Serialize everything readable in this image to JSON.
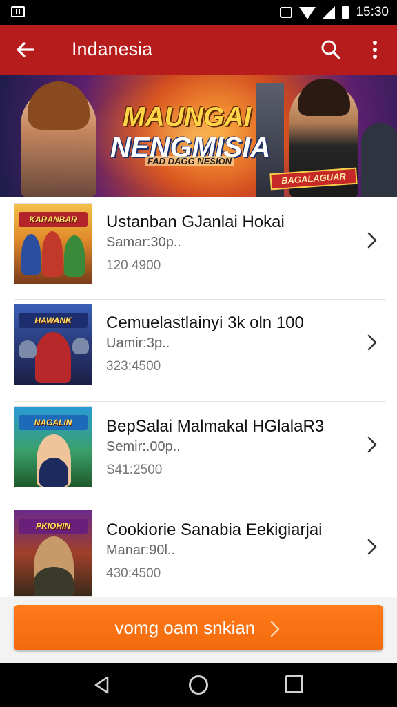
{
  "status_bar": {
    "time": "15:30",
    "icons": [
      "gallery-icon",
      "vibrate-icon",
      "wifi-icon",
      "signal-icon",
      "battery-icon"
    ]
  },
  "app_bar": {
    "title": "Indanesia",
    "back_icon": "arrow-back-icon",
    "search_icon": "search-icon",
    "more_icon": "more-vert-icon"
  },
  "banner": {
    "title_line1": "MAUNGAI",
    "title_line2": "NENGMISIA",
    "subtitle": "FAD DAGG NESION",
    "sign": "BAGALAGUAR"
  },
  "items": [
    {
      "title": "Ustanban GJanlai Hokai",
      "subtitle": "Samar:30p..",
      "count": "120 4900",
      "thumb_caption": "KARANBAR"
    },
    {
      "title": "Cemuelastlainyi 3k oln 100",
      "subtitle": "Uamir:3p..",
      "count": "323:4500",
      "thumb_caption": "HAWANK"
    },
    {
      "title": "BepSalai Malmakal HGlalaR3",
      "subtitle": "Semir:.00p..",
      "count": "S41:2500",
      "thumb_caption": "NAGALIN"
    },
    {
      "title": "Cookiorie Sanabia Eekigiarjai",
      "subtitle": "Manar:90l..",
      "count": "430:4500",
      "thumb_caption": "PKIOHIN"
    }
  ],
  "cta": {
    "label": "vomg oam snkian"
  },
  "colors": {
    "app_bar": "#b71c1c",
    "cta": "#f26a0c",
    "list_bg": "#ffffff"
  }
}
